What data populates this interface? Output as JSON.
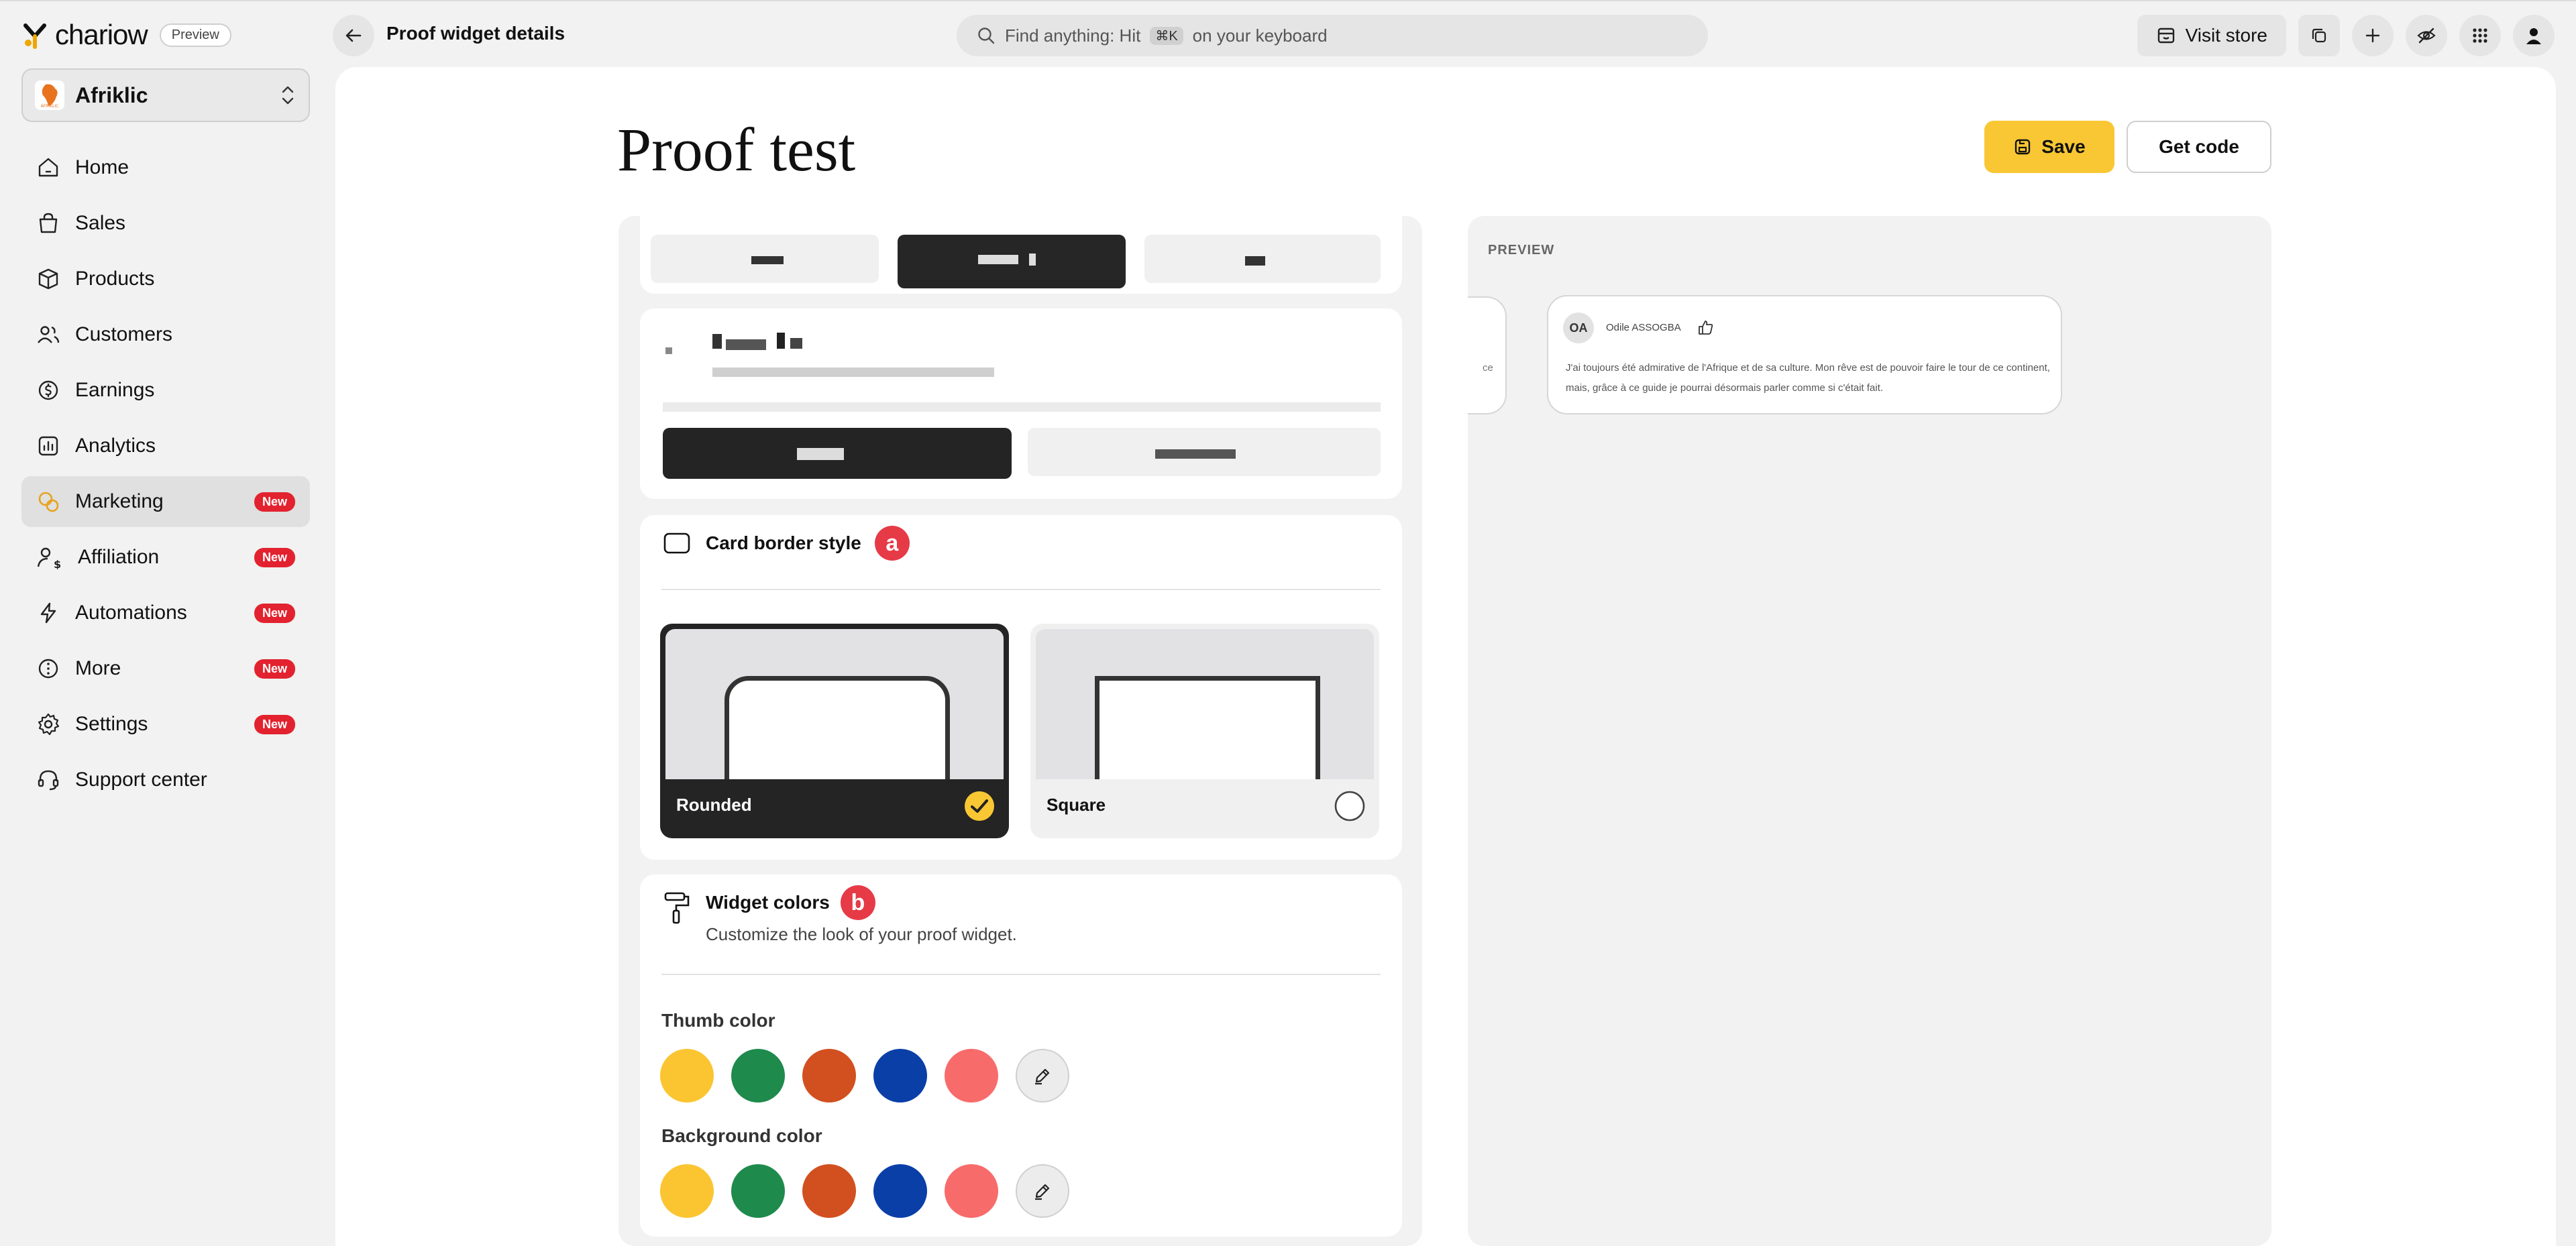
{
  "app": {
    "brand_name": "chariow",
    "preview_badge": "Preview",
    "page_heading": "Proof widget details"
  },
  "search": {
    "prefix": "Find anything: Hit",
    "shortcut": "⌘K",
    "suffix": "on your keyboard"
  },
  "top_actions": {
    "visit_store": "Visit store"
  },
  "store": {
    "name": "Afriklic",
    "logo_text": "AFRIKLIC"
  },
  "sidebar": {
    "items": [
      {
        "label": "Home",
        "badge": ""
      },
      {
        "label": "Sales",
        "badge": ""
      },
      {
        "label": "Products",
        "badge": ""
      },
      {
        "label": "Customers",
        "badge": ""
      },
      {
        "label": "Earnings",
        "badge": ""
      },
      {
        "label": "Analytics",
        "badge": ""
      },
      {
        "label": "Marketing",
        "badge": "New"
      },
      {
        "label": "Affiliation",
        "badge": "New"
      },
      {
        "label": "Automations",
        "badge": "New"
      },
      {
        "label": "More",
        "badge": "New"
      },
      {
        "label": "Settings",
        "badge": "New"
      },
      {
        "label": "Support center",
        "badge": ""
      }
    ]
  },
  "main": {
    "title": "Proof test",
    "save_label": "Save",
    "get_code_label": "Get code"
  },
  "border_style": {
    "title": "Card border style",
    "marker": "a",
    "options": [
      {
        "label": "Rounded",
        "selected": true
      },
      {
        "label": "Square",
        "selected": false
      }
    ]
  },
  "widget_colors": {
    "title": "Widget colors",
    "marker": "b",
    "subtitle": "Customize the look of your proof widget.",
    "thumb_label": "Thumb color",
    "background_label": "Background color",
    "palette": [
      "#fbc531",
      "#1e8a4c",
      "#d2501f",
      "#0a3fa8",
      "#f86b6b"
    ]
  },
  "preview": {
    "label": "PREVIEW",
    "partial_text": "ce",
    "review": {
      "initials": "OA",
      "name": "Odile ASSOGBA",
      "text": "J'ai toujours été admirative de l'Afrique et de sa culture. Mon rêve est de pouvoir faire le tour de ce continent, mais, grâce à ce guide je pourrai désormais parler comme si c'était fait."
    }
  },
  "colors": {
    "accent_yellow": "#f9c733",
    "badge_red": "#e3222f",
    "marker_red": "#e63a47",
    "dark": "#242424"
  }
}
